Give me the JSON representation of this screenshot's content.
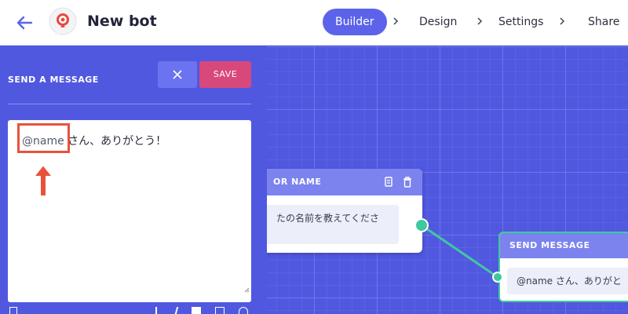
{
  "header": {
    "title": "New bot",
    "steps": [
      {
        "label": "Builder",
        "active": true
      },
      {
        "label": "Design",
        "active": false
      },
      {
        "label": "Settings",
        "active": false
      },
      {
        "label": "Share",
        "active": false
      }
    ]
  },
  "panel": {
    "title": "SEND A MESSAGE",
    "save_label": "SAVE",
    "editor": {
      "variable": "@name",
      "text": " さん、ありがとう！"
    }
  },
  "nodes": [
    {
      "header": "OR NAME",
      "message": "たの名前を教えてくださ"
    },
    {
      "header": "SEND MESSAGE",
      "message": "@name さん、ありがと"
    }
  ],
  "colors": {
    "brand": "#5c63ea",
    "canvas": "#5158e0",
    "save": "#d9487a",
    "connector": "#3ec9a0",
    "highlight": "#e8523c"
  },
  "icons": [
    "back-arrow-icon",
    "bot-logo-icon",
    "chevron-right-icon",
    "close-icon",
    "copy-icon",
    "trash-icon",
    "up-arrow-icon"
  ]
}
